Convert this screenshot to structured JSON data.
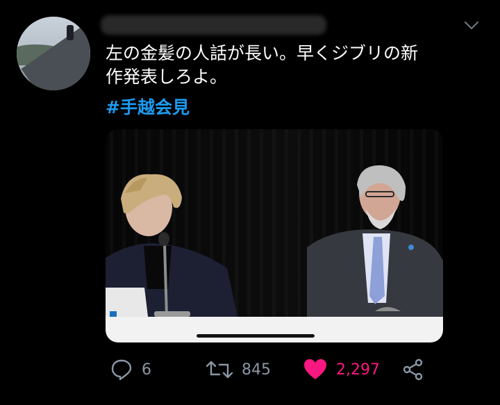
{
  "tweet": {
    "text": "左の金髪の人話が長い。早くジブリの新\n作発表しろよ。",
    "hashtag": "#手越会見"
  },
  "actions": {
    "replies": "6",
    "retweets": "845",
    "likes": "2,297"
  },
  "colors": {
    "background": "#000000",
    "hashtag": "#1d9bf0",
    "like": "#f91880",
    "icon": "#8b98a5"
  },
  "icons": [
    "chevron-down-icon",
    "reply-icon",
    "retweet-icon",
    "heart-icon",
    "share-icon"
  ]
}
